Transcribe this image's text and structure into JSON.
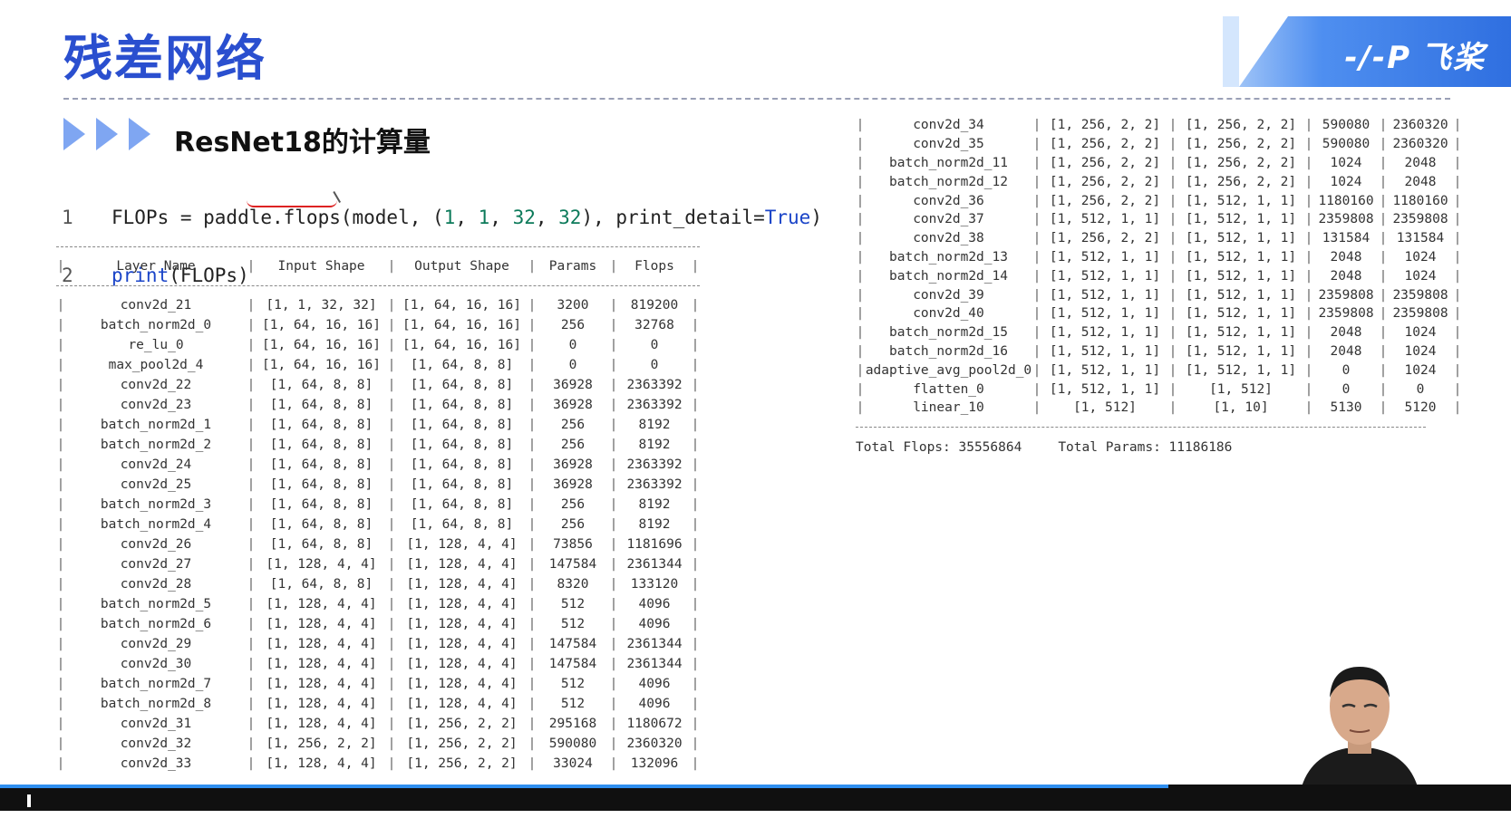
{
  "slide": {
    "title": "残差网络",
    "section_title": "ResNet18的计算量",
    "logo_text": "飞桨"
  },
  "code": {
    "line1_no": "1",
    "line1_a": "FLOPs = paddle.flops(model, (",
    "line1_b": "1",
    "line1_c": ", ",
    "line1_d": "1",
    "line1_e": ", ",
    "line1_f": "32",
    "line1_g": ", ",
    "line1_h": "32",
    "line1_i": "), print_detail=",
    "line1_j": "True",
    "line1_k": ")",
    "line2_no": "2",
    "line2_a": "print",
    "line2_b": "(FLOPs)"
  },
  "table": {
    "headers": [
      "Layer Name",
      "Input Shape",
      "Output Shape",
      "Params",
      "Flops"
    ],
    "left_rows": [
      [
        "conv2d_21",
        "[1, 1, 32, 32]",
        "[1, 64, 16, 16]",
        "3200",
        "819200"
      ],
      [
        "batch_norm2d_0",
        "[1, 64, 16, 16]",
        "[1, 64, 16, 16]",
        "256",
        "32768"
      ],
      [
        "re_lu_0",
        "[1, 64, 16, 16]",
        "[1, 64, 16, 16]",
        "0",
        "0"
      ],
      [
        "max_pool2d_4",
        "[1, 64, 16, 16]",
        "[1, 64, 8, 8]",
        "0",
        "0"
      ],
      [
        "conv2d_22",
        "[1, 64, 8, 8]",
        "[1, 64, 8, 8]",
        "36928",
        "2363392"
      ],
      [
        "conv2d_23",
        "[1, 64, 8, 8]",
        "[1, 64, 8, 8]",
        "36928",
        "2363392"
      ],
      [
        "batch_norm2d_1",
        "[1, 64, 8, 8]",
        "[1, 64, 8, 8]",
        "256",
        "8192"
      ],
      [
        "batch_norm2d_2",
        "[1, 64, 8, 8]",
        "[1, 64, 8, 8]",
        "256",
        "8192"
      ],
      [
        "conv2d_24",
        "[1, 64, 8, 8]",
        "[1, 64, 8, 8]",
        "36928",
        "2363392"
      ],
      [
        "conv2d_25",
        "[1, 64, 8, 8]",
        "[1, 64, 8, 8]",
        "36928",
        "2363392"
      ],
      [
        "batch_norm2d_3",
        "[1, 64, 8, 8]",
        "[1, 64, 8, 8]",
        "256",
        "8192"
      ],
      [
        "batch_norm2d_4",
        "[1, 64, 8, 8]",
        "[1, 64, 8, 8]",
        "256",
        "8192"
      ],
      [
        "conv2d_26",
        "[1, 64, 8, 8]",
        "[1, 128, 4, 4]",
        "73856",
        "1181696"
      ],
      [
        "conv2d_27",
        "[1, 128, 4, 4]",
        "[1, 128, 4, 4]",
        "147584",
        "2361344"
      ],
      [
        "conv2d_28",
        "[1, 64, 8, 8]",
        "[1, 128, 4, 4]",
        "8320",
        "133120"
      ],
      [
        "batch_norm2d_5",
        "[1, 128, 4, 4]",
        "[1, 128, 4, 4]",
        "512",
        "4096"
      ],
      [
        "batch_norm2d_6",
        "[1, 128, 4, 4]",
        "[1, 128, 4, 4]",
        "512",
        "4096"
      ],
      [
        "conv2d_29",
        "[1, 128, 4, 4]",
        "[1, 128, 4, 4]",
        "147584",
        "2361344"
      ],
      [
        "conv2d_30",
        "[1, 128, 4, 4]",
        "[1, 128, 4, 4]",
        "147584",
        "2361344"
      ],
      [
        "batch_norm2d_7",
        "[1, 128, 4, 4]",
        "[1, 128, 4, 4]",
        "512",
        "4096"
      ],
      [
        "batch_norm2d_8",
        "[1, 128, 4, 4]",
        "[1, 128, 4, 4]",
        "512",
        "4096"
      ],
      [
        "conv2d_31",
        "[1, 128, 4, 4]",
        "[1, 256, 2, 2]",
        "295168",
        "1180672"
      ],
      [
        "conv2d_32",
        "[1, 256, 2, 2]",
        "[1, 256, 2, 2]",
        "590080",
        "2360320"
      ],
      [
        "conv2d_33",
        "[1, 128, 4, 4]",
        "[1, 256, 2, 2]",
        "33024",
        "132096"
      ]
    ],
    "right_rows": [
      [
        "conv2d_34",
        "[1, 256, 2, 2]",
        "[1, 256, 2, 2]",
        "590080",
        "2360320"
      ],
      [
        "conv2d_35",
        "[1, 256, 2, 2]",
        "[1, 256, 2, 2]",
        "590080",
        "2360320"
      ],
      [
        "batch_norm2d_11",
        "[1, 256, 2, 2]",
        "[1, 256, 2, 2]",
        "1024",
        "2048"
      ],
      [
        "batch_norm2d_12",
        "[1, 256, 2, 2]",
        "[1, 256, 2, 2]",
        "1024",
        "2048"
      ],
      [
        "conv2d_36",
        "[1, 256, 2, 2]",
        "[1, 512, 1, 1]",
        "1180160",
        "1180160"
      ],
      [
        "conv2d_37",
        "[1, 512, 1, 1]",
        "[1, 512, 1, 1]",
        "2359808",
        "2359808"
      ],
      [
        "conv2d_38",
        "[1, 256, 2, 2]",
        "[1, 512, 1, 1]",
        "131584",
        "131584"
      ],
      [
        "batch_norm2d_13",
        "[1, 512, 1, 1]",
        "[1, 512, 1, 1]",
        "2048",
        "1024"
      ],
      [
        "batch_norm2d_14",
        "[1, 512, 1, 1]",
        "[1, 512, 1, 1]",
        "2048",
        "1024"
      ],
      [
        "conv2d_39",
        "[1, 512, 1, 1]",
        "[1, 512, 1, 1]",
        "2359808",
        "2359808"
      ],
      [
        "conv2d_40",
        "[1, 512, 1, 1]",
        "[1, 512, 1, 1]",
        "2359808",
        "2359808"
      ],
      [
        "batch_norm2d_15",
        "[1, 512, 1, 1]",
        "[1, 512, 1, 1]",
        "2048",
        "1024"
      ],
      [
        "batch_norm2d_16",
        "[1, 512, 1, 1]",
        "[1, 512, 1, 1]",
        "2048",
        "1024"
      ],
      [
        "adaptive_avg_pool2d_0",
        "[1, 512, 1, 1]",
        "[1, 512, 1, 1]",
        "0",
        "1024"
      ],
      [
        "flatten_0",
        "[1, 512, 1, 1]",
        "[1, 512]",
        "0",
        "0"
      ],
      [
        "linear_10",
        "[1, 512]",
        "[1, 10]",
        "5130",
        "5120"
      ]
    ],
    "total_flops": "Total Flops: 35556864",
    "total_params": "Total Params: 11186186"
  },
  "player": {
    "progress_fraction": 0.773
  }
}
